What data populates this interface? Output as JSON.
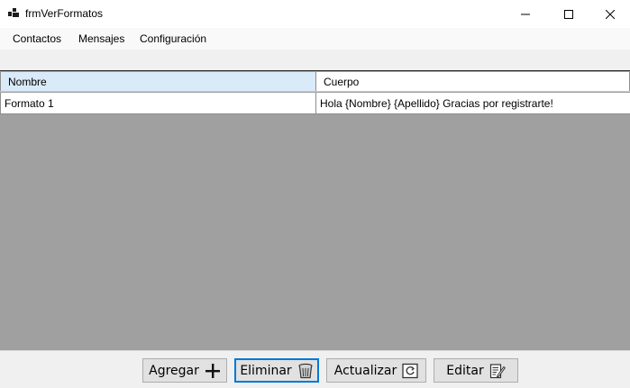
{
  "window": {
    "title": "frmVerFormatos",
    "controls": {
      "minimize": "minimize-icon",
      "maximize": "maximize-icon",
      "close": "close-icon"
    }
  },
  "menu": {
    "items": [
      {
        "label": "Contactos"
      },
      {
        "label": "Mensajes"
      },
      {
        "label": "Configuración"
      }
    ]
  },
  "grid": {
    "columns": [
      "Nombre",
      "Cuerpo"
    ],
    "rows": [
      [
        "Formato 1",
        "Hola {Nombre} {Apellido} Gracias por registrarte!"
      ]
    ],
    "colors": {
      "header_selected": "#d9eaf9",
      "empty_area": "#a0a0a0"
    }
  },
  "buttons": {
    "add": {
      "label": "Agregar",
      "icon": "plus-icon"
    },
    "delete": {
      "label": "Eliminar",
      "icon": "trash-icon"
    },
    "refresh": {
      "label": "Actualizar",
      "icon": "refresh-icon"
    },
    "edit": {
      "label": "Editar",
      "icon": "edit-icon"
    }
  }
}
